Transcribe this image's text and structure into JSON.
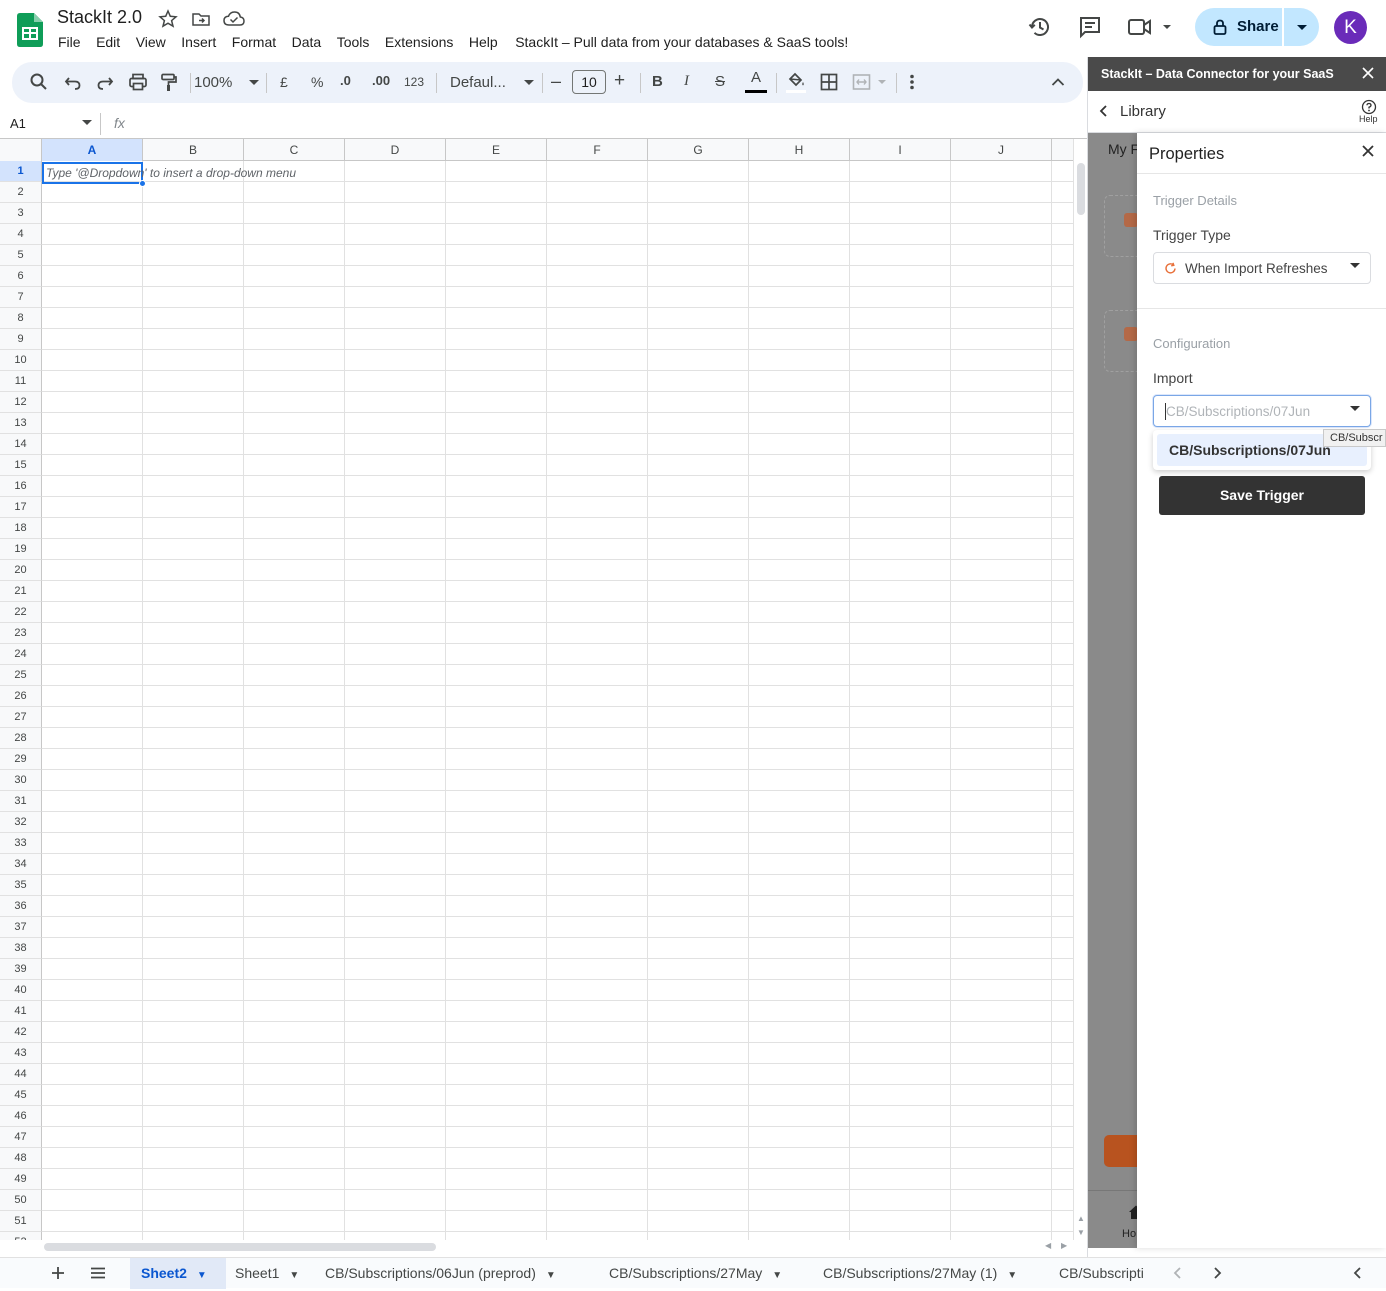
{
  "doc": {
    "title": "StackIt 2.0",
    "menu": [
      "File",
      "Edit",
      "View",
      "Insert",
      "Format",
      "Data",
      "Tools",
      "Extensions",
      "Help"
    ],
    "tagline": "StackIt – Pull data from your databases & SaaS tools!"
  },
  "header": {
    "share_label": "Share",
    "avatar_initial": "K"
  },
  "toolbar": {
    "zoom": "100%",
    "currency": "£",
    "percent": "%",
    "dec_decrease": ".0",
    "dec_increase": ".00",
    "number_format": "123",
    "font": "Defaul...",
    "font_size": "10",
    "size_minus": "–",
    "size_plus": "+",
    "bold": "B",
    "italic": "I",
    "strike": "S",
    "text_color": "A"
  },
  "formula": {
    "cell_ref": "A1",
    "fx": "fx"
  },
  "grid": {
    "columns": [
      "A",
      "B",
      "C",
      "D",
      "E",
      "F",
      "G",
      "H",
      "I",
      "J"
    ],
    "selected_column": "A",
    "selected_row": 1,
    "cell_hint": "Type '@Dropdown' to insert a drop-down menu"
  },
  "sheets": {
    "tabs": [
      "Sheet2",
      "Sheet1",
      "CB/Subscriptions/06Jun (preprod)",
      "CB/Subscriptions/27May",
      "CB/Subscriptions/27May (1)",
      "CB/Subscripti"
    ],
    "active": "Sheet2"
  },
  "sidepanel": {
    "title": "StackIt – Data Connector for your SaaS",
    "library": "Library",
    "help": "Help",
    "behind_text": "My Fi",
    "footer_home": "Ho"
  },
  "properties": {
    "title": "Properties",
    "trigger_details": "Trigger Details",
    "trigger_type_label": "Trigger Type",
    "trigger_type_value": "When Import Refreshes",
    "configuration": "Configuration",
    "import_label": "Import",
    "import_placeholder": "CB/Subscriptions/07Jun",
    "option": "CB/Subscriptions/07Jun",
    "save_label": "Save Trigger",
    "tooltip": "CB/Subscr"
  },
  "colors": {
    "accent_blue": "#0b57d0",
    "share_bg": "#c2e7ff",
    "avatar_bg": "#6a2bb9",
    "refresh_orange": "#e8703a",
    "save_bg": "#333333"
  }
}
